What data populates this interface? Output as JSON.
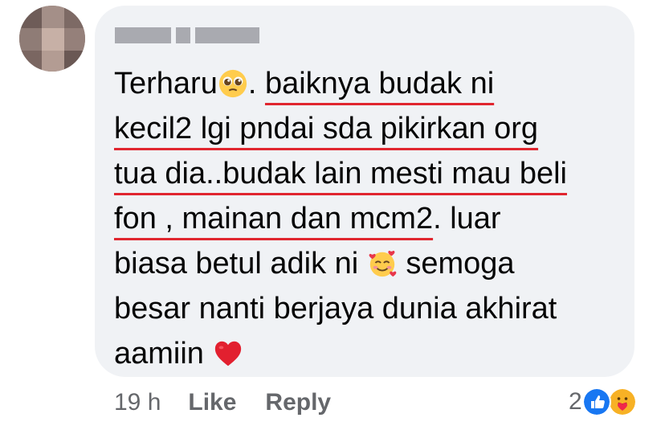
{
  "comment": {
    "author_name": "",
    "lines": [
      {
        "parts": [
          {
            "text": "Terharu",
            "underline": false
          },
          {
            "emoji": "pleading-face-icon"
          },
          {
            "text": ". ",
            "underline": false
          },
          {
            "text": "baiknya budak ni",
            "underline": true
          }
        ]
      },
      {
        "parts": [
          {
            "text": "kecil2 lgi pndai sda pikirkan org",
            "underline": true
          }
        ]
      },
      {
        "parts": [
          {
            "text": "tua dia..budak lain mesti mau beli",
            "underline": true
          }
        ]
      },
      {
        "parts": [
          {
            "text": "fon , mainan dan mcm2",
            "underline": true
          },
          {
            "text": ". luar",
            "underline": false
          }
        ]
      },
      {
        "parts": [
          {
            "text": "biasa betul adik ni ",
            "underline": false
          },
          {
            "emoji": "smiling-face-with-hearts-icon"
          },
          {
            "text": " semoga",
            "underline": false
          }
        ]
      },
      {
        "parts": [
          {
            "text": "besar nanti berjaya dunia akhirat",
            "underline": false
          }
        ]
      },
      {
        "parts": [
          {
            "text": "aamiin ",
            "underline": false
          },
          {
            "emoji": "red-heart-icon"
          }
        ]
      }
    ],
    "underline_color": "#e0262f"
  },
  "footer": {
    "time": "19 h",
    "like_label": "Like",
    "reply_label": "Reply"
  },
  "reactions": {
    "count": "2",
    "icons": [
      "like-reaction-icon",
      "care-reaction-icon"
    ]
  },
  "colors": {
    "bubble": "#f0f2f5",
    "text": "#050505",
    "meta": "#65676b",
    "like_blue": "#1877f2"
  }
}
